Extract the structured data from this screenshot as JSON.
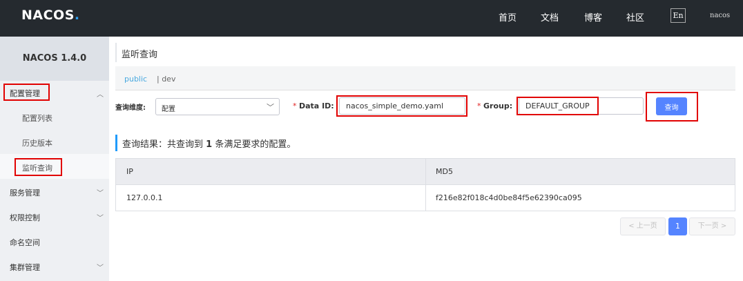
{
  "header": {
    "logo": "NACOS",
    "nav": [
      "首页",
      "文档",
      "博客",
      "社区"
    ],
    "lang": "En",
    "user": "nacos"
  },
  "sidebar": {
    "version": "NACOS 1.4.0",
    "groups": [
      {
        "label": "配置管理",
        "expanded": true
      },
      {
        "label": "服务管理"
      },
      {
        "label": "权限控制"
      },
      {
        "label": "命名空间"
      },
      {
        "label": "集群管理"
      }
    ],
    "config_items": [
      "配置列表",
      "历史版本",
      "监听查询"
    ],
    "active_item": "监听查询"
  },
  "main": {
    "title": "监听查询",
    "namespaces": [
      "public",
      "| dev"
    ],
    "active_namespace": "public",
    "query_dimension_label": "查询维度:",
    "query_dimension_value": "配置",
    "data_id_label": "Data ID:",
    "data_id_value": "nacos_simple_demo.yaml",
    "group_label": "Group:",
    "group_value": "DEFAULT_GROUP",
    "query_button": "查询",
    "result_prefix": "查询结果：共查询到",
    "result_count": "1",
    "result_suffix": "条满足要求的配置。",
    "table": {
      "columns": [
        "IP",
        "MD5"
      ],
      "rows": [
        [
          "127.0.0.1",
          "f216e82f018c4d0be84f5e62390ca095"
        ]
      ]
    },
    "pagination": {
      "prev": "< 上一页",
      "current": "1",
      "next": "下一页 >"
    }
  },
  "colors": {
    "topbar": "#252a2f",
    "accent": "#5584ff",
    "highlight": "#e10000",
    "namespace_active": "#47a8df"
  }
}
